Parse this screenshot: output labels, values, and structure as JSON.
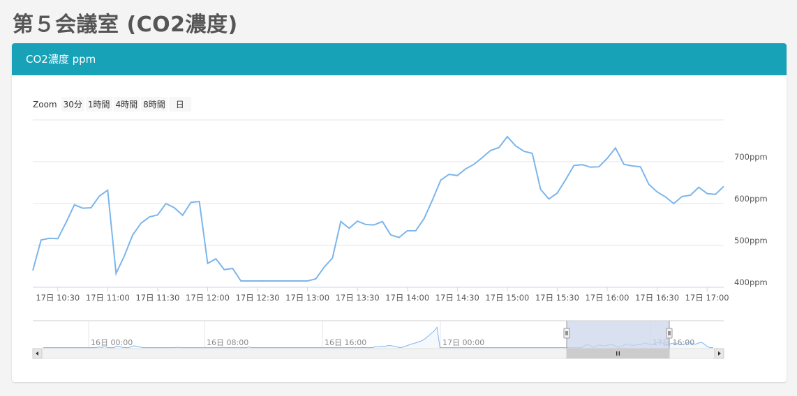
{
  "page_title": "第５会議室 (CO2濃度)",
  "panel_header": "CO2濃度 ppm",
  "zoom": {
    "label": "Zoom",
    "buttons": [
      "30分",
      "1時間",
      "4時間",
      "8時間",
      "日"
    ]
  },
  "colors": {
    "header": "#17a2b8",
    "line": "#7cb5ec",
    "navigator_mask": "#ccd6eb"
  },
  "chart_data": {
    "type": "line",
    "x_start": "17日 10:15",
    "x_interval_minutes": 5,
    "values": [
      440,
      513,
      517,
      516,
      555,
      597,
      589,
      590,
      618,
      632,
      433,
      475,
      525,
      553,
      568,
      573,
      600,
      590,
      572,
      603,
      605,
      457,
      468,
      442,
      445,
      415,
      415,
      415,
      415,
      415,
      415,
      415,
      415,
      415,
      420,
      448,
      470,
      557,
      541,
      558,
      550,
      549,
      557,
      525,
      519,
      535,
      535,
      564,
      608,
      656,
      670,
      667,
      683,
      694,
      710,
      727,
      734,
      760,
      738,
      725,
      720,
      634,
      611,
      625,
      657,
      691,
      693,
      687,
      688,
      708,
      733,
      694,
      690,
      688,
      646,
      628,
      616,
      600,
      617,
      620,
      639,
      624,
      622,
      641
    ],
    "x_tick_labels": [
      "17日 10:30",
      "17日 11:00",
      "17日 11:30",
      "17日 12:00",
      "17日 12:30",
      "17日 13:00",
      "17日 13:30",
      "17日 14:00",
      "17日 14:30",
      "17日 15:00",
      "17日 15:30",
      "17日 16:00",
      "17日 16:30",
      "17日 17:00"
    ],
    "y_tick_labels": [
      "400ppm",
      "500ppm",
      "600ppm",
      "700ppm"
    ],
    "y_ticks": [
      400,
      500,
      600,
      700
    ],
    "ylim": [
      400,
      800
    ],
    "grid": true,
    "navigator": {
      "tick_labels": [
        "16日 00:00",
        "16日 08:00",
        "16日 16:00",
        "17日 00:00",
        "17日 16:00"
      ],
      "values": [
        415,
        415,
        415,
        415,
        415,
        415,
        415,
        415,
        415,
        415,
        415,
        415,
        415,
        415,
        415,
        415,
        415,
        415,
        418,
        425,
        420,
        430,
        415,
        415,
        415,
        440,
        430,
        420,
        415,
        415,
        435,
        445,
        430,
        425,
        415,
        415,
        415,
        415,
        415,
        415,
        415,
        415,
        415,
        415,
        415,
        418,
        420,
        415,
        415,
        415,
        415,
        415,
        415,
        415,
        415,
        415,
        415,
        415,
        415,
        415,
        415,
        420,
        415,
        415,
        415,
        415,
        415,
        415,
        415,
        415,
        425,
        415,
        415,
        415,
        415,
        415,
        415,
        415,
        415,
        415,
        415,
        415,
        415,
        415,
        415,
        415,
        415,
        415,
        415,
        415,
        415,
        415,
        415,
        415,
        415,
        415,
        415,
        415,
        415,
        415,
        415,
        415,
        415,
        415,
        415,
        415,
        415,
        415,
        415,
        418,
        415,
        415,
        415,
        430,
        425,
        440,
        430,
        445,
        450,
        440,
        430,
        420,
        420,
        435,
        450,
        470,
        480,
        495,
        510,
        530,
        560,
        600,
        640,
        680,
        740,
        415,
        415,
        415,
        415,
        415,
        415,
        415,
        415,
        415,
        415,
        415,
        415,
        415,
        415,
        415,
        415,
        415,
        415,
        415,
        415,
        415,
        415,
        415,
        415,
        415,
        415,
        415,
        415,
        415,
        415,
        415,
        415,
        415,
        415,
        415,
        415,
        415,
        415,
        415,
        415,
        415,
        415,
        415,
        415,
        415,
        415,
        415,
        415,
        415,
        440,
        470,
        450,
        420,
        430,
        460,
        450,
        440,
        455,
        470,
        460,
        430,
        420,
        440,
        465,
        470,
        455,
        450,
        470,
        460,
        480,
        490,
        470,
        465,
        480,
        495,
        500,
        480,
        470,
        470,
        485,
        490,
        475,
        460,
        470,
        490,
        500,
        480,
        470,
        490,
        500,
        470,
        430,
        415,
        415
      ]
    }
  }
}
